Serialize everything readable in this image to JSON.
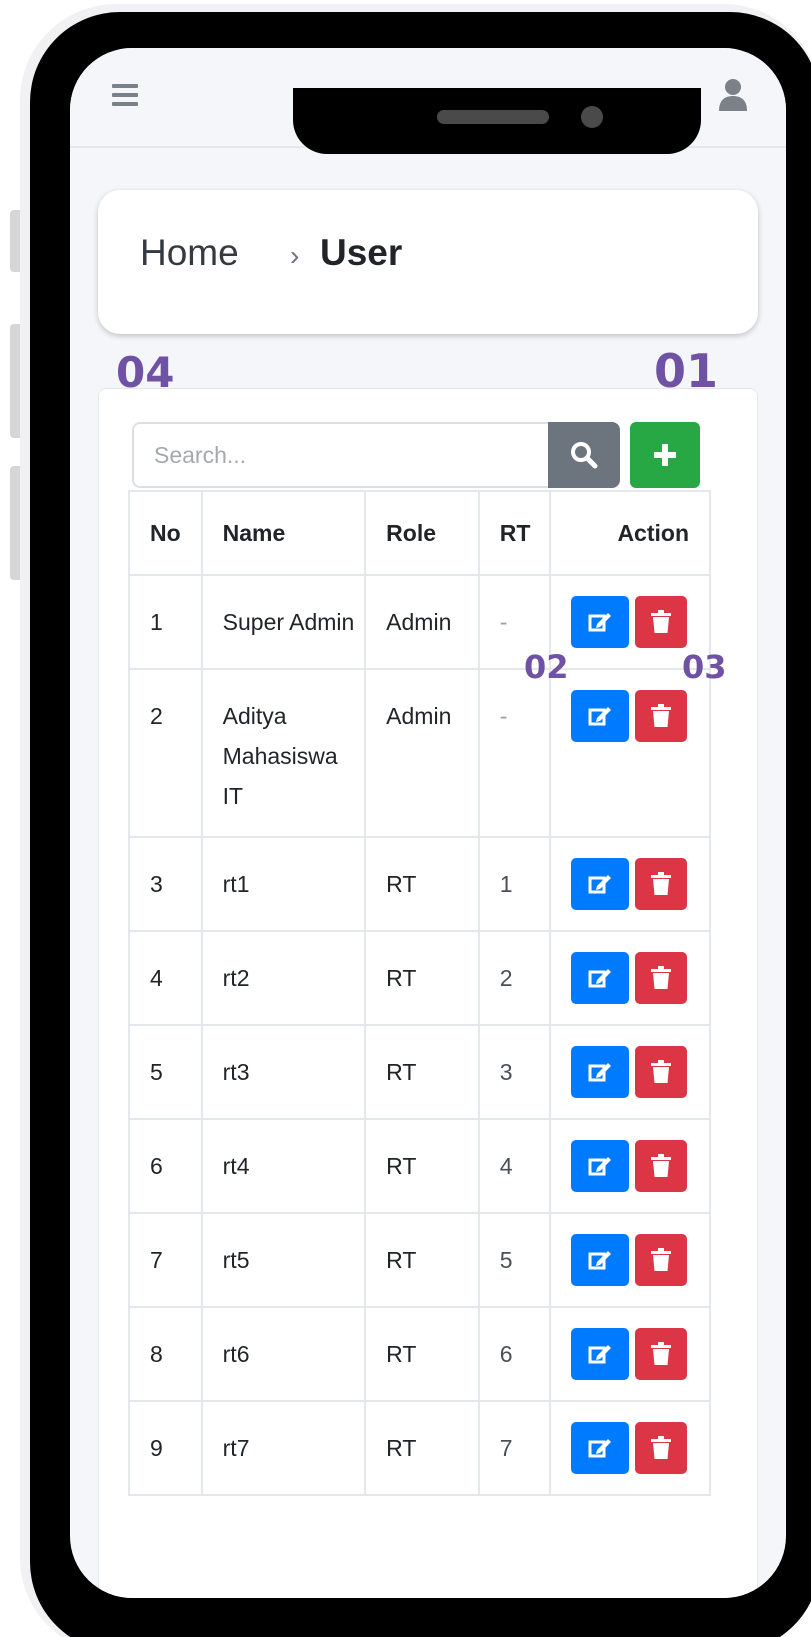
{
  "breadcrumb": {
    "home": "Home",
    "separator": "›",
    "current": "User"
  },
  "search": {
    "placeholder": "Search..."
  },
  "callouts": {
    "add": "01",
    "edit": "02",
    "delete": "03",
    "search": "04"
  },
  "table": {
    "headers": {
      "no": "No",
      "name": "Name",
      "role": "Role",
      "rt": "RT",
      "action": "Action"
    },
    "rows": [
      {
        "no": "1",
        "name": "Super Admin",
        "role": "Admin",
        "rt": "-"
      },
      {
        "no": "2",
        "name": "Aditya Mahasiswa IT",
        "role": "Admin",
        "rt": "-"
      },
      {
        "no": "3",
        "name": "rt1",
        "role": "RT",
        "rt": "1"
      },
      {
        "no": "4",
        "name": "rt2",
        "role": "RT",
        "rt": "2"
      },
      {
        "no": "5",
        "name": "rt3",
        "role": "RT",
        "rt": "3"
      },
      {
        "no": "6",
        "name": "rt4",
        "role": "RT",
        "rt": "4"
      },
      {
        "no": "7",
        "name": "rt5",
        "role": "RT",
        "rt": "5"
      },
      {
        "no": "8",
        "name": "rt6",
        "role": "RT",
        "rt": "6"
      },
      {
        "no": "9",
        "name": "rt7",
        "role": "RT",
        "rt": "7"
      }
    ]
  },
  "icons": {
    "menu": "hamburger-icon",
    "user": "user-icon",
    "search": "search-icon",
    "add": "plus-icon",
    "edit": "edit-icon",
    "delete": "trash-icon"
  },
  "colors": {
    "add_button": "#28a745",
    "search_button": "#6c757d",
    "edit_button": "#007bff",
    "delete_button": "#dc3545",
    "callout": "#6f52a3"
  }
}
